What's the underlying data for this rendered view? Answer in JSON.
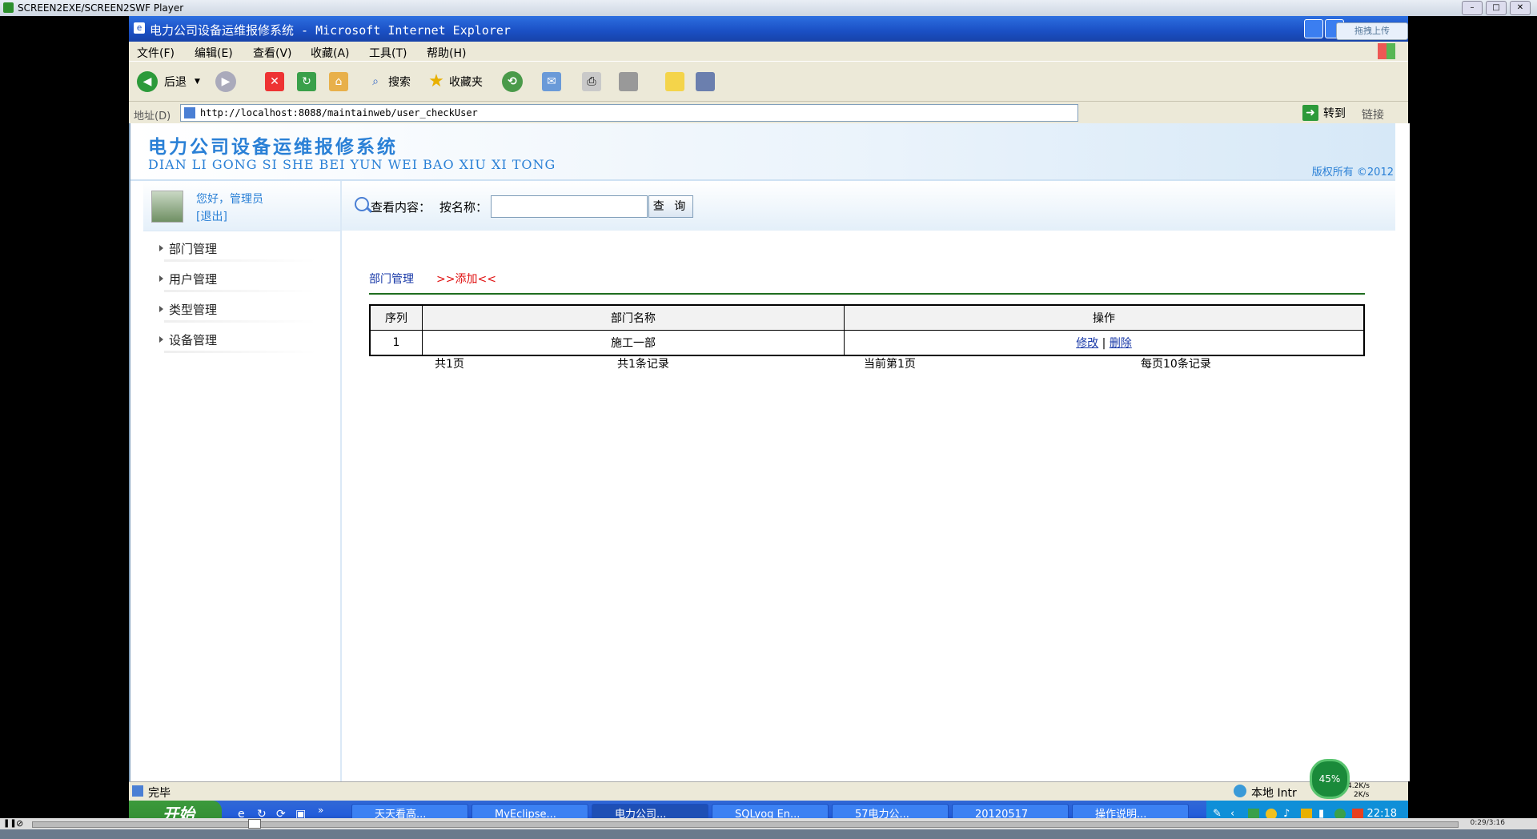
{
  "player": {
    "title": "SCREEN2EXE/SCREEN2SWF Player",
    "time": "0:29/3:16"
  },
  "window": {
    "title": "电力公司设备运维报修系统 - Microsoft Internet Explorer",
    "upload_label": "拖拽上传"
  },
  "menu": {
    "file": "文件(F)",
    "edit": "编辑(E)",
    "view": "查看(V)",
    "favorites": "收藏(A)",
    "tools": "工具(T)",
    "help": "帮助(H)"
  },
  "toolbar": {
    "back": "后退",
    "search": "搜索",
    "favorites": "收藏夹"
  },
  "address": {
    "label": "地址(D)",
    "url": "http://localhost:8088/maintainweb/user_checkUser",
    "go": "转到",
    "links": "链接"
  },
  "banner": {
    "title_cn": "电力公司设备运维报修系统",
    "title_pinyin": "DIAN LI GONG SI SHE BEI YUN WEI BAO XIU XI TONG",
    "copyright": "版权所有 ©2012"
  },
  "user": {
    "greeting": "您好，管理员",
    "logout": "[退出]"
  },
  "sidebar": {
    "items": [
      {
        "label": "部门管理"
      },
      {
        "label": "用户管理"
      },
      {
        "label": "类型管理"
      },
      {
        "label": "设备管理"
      }
    ]
  },
  "search": {
    "label": "查看内容：",
    "field_label": "按名称：",
    "value": "",
    "button": "查 询"
  },
  "content": {
    "breadcrumb": "部门管理",
    "add_link": ">>添加<<"
  },
  "table": {
    "headers": [
      "序列",
      "部门名称",
      "操作"
    ],
    "rows": [
      {
        "index": "1",
        "name": "施工一部",
        "edit": "修改",
        "sep": "|",
        "delete": "删除"
      }
    ]
  },
  "pager": {
    "total_pages": "共1页",
    "total_records": "共1条记录",
    "current": "当前第1页",
    "per_page": "每页10条记录"
  },
  "status": {
    "text": "完毕",
    "zone": "本地 Intr",
    "speed_pct": "45%",
    "up": "4.2K/s",
    "down": "2K/s"
  },
  "taskbar": {
    "start": "开始",
    "tasks": [
      "天天看高...",
      "MyEclipse...",
      "电力公司...",
      "SQLyog En...",
      "57电力公...",
      "20120517",
      "操作说明..."
    ],
    "clock": "22:18"
  }
}
